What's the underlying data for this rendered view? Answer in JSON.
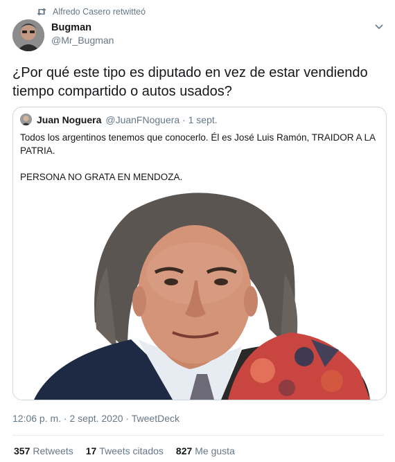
{
  "retweet": {
    "text": "Alfredo Casero retwitteó",
    "icon": "retweet-icon"
  },
  "tweet": {
    "author_name": "Bugman",
    "author_handle": "@Mr_Bugman",
    "text": "¿Por qué este tipo es diputado en vez de estar vendiendo tiempo compartido o autos usados?",
    "timestamp": "12:06 p. m. · 2 sept. 2020 · TweetDeck"
  },
  "quote": {
    "author_name": "Juan Noguera",
    "author_meta": "@JuanFNoguera · 1 sept.",
    "text": "Todos los argentinos tenemos que conocerlo. Él es José Luis Ramón, TRAIDOR A LA PATRIA.\n\nPERSONA NO GRATA EN MENDOZA."
  },
  "stats": {
    "retweets_count": "357",
    "retweets_label": "Retweets",
    "quotes_count": "17",
    "quotes_label": "Tweets citados",
    "likes_count": "827",
    "likes_label": "Me gusta"
  },
  "colors": {
    "secondary_text": "#657786",
    "border": "#ccd6dd",
    "primary_text": "#14171a"
  }
}
